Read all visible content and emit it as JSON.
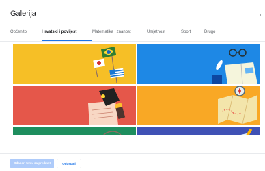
{
  "dialog": {
    "title": "Galerija",
    "tabs": [
      {
        "label": "Općenito",
        "active": false
      },
      {
        "label": "Hrvatski i povijest",
        "active": true
      },
      {
        "label": "Matematika i znanost",
        "active": false
      },
      {
        "label": "Umjetnost",
        "active": false
      },
      {
        "label": "Sport",
        "active": false
      },
      {
        "label": "Drugo",
        "active": false
      }
    ],
    "tiles": [
      {
        "name": "flags-theme",
        "color": "#f6bf26"
      },
      {
        "name": "books-glasses-theme",
        "color": "#1e88e5"
      },
      {
        "name": "writing-hand-theme",
        "color": "#e5574a"
      },
      {
        "name": "map-compass-theme",
        "color": "#f9a825"
      },
      {
        "name": "globe-theme",
        "color": "#1e8e5e"
      },
      {
        "name": "notes-theme",
        "color": "#3f51b5"
      }
    ],
    "primary_button": "Odaberi temu za predmet",
    "cancel_button": "Odustani",
    "colors": {
      "accent": "#1a73e8",
      "primary_disabled": "#aecbfa"
    }
  }
}
